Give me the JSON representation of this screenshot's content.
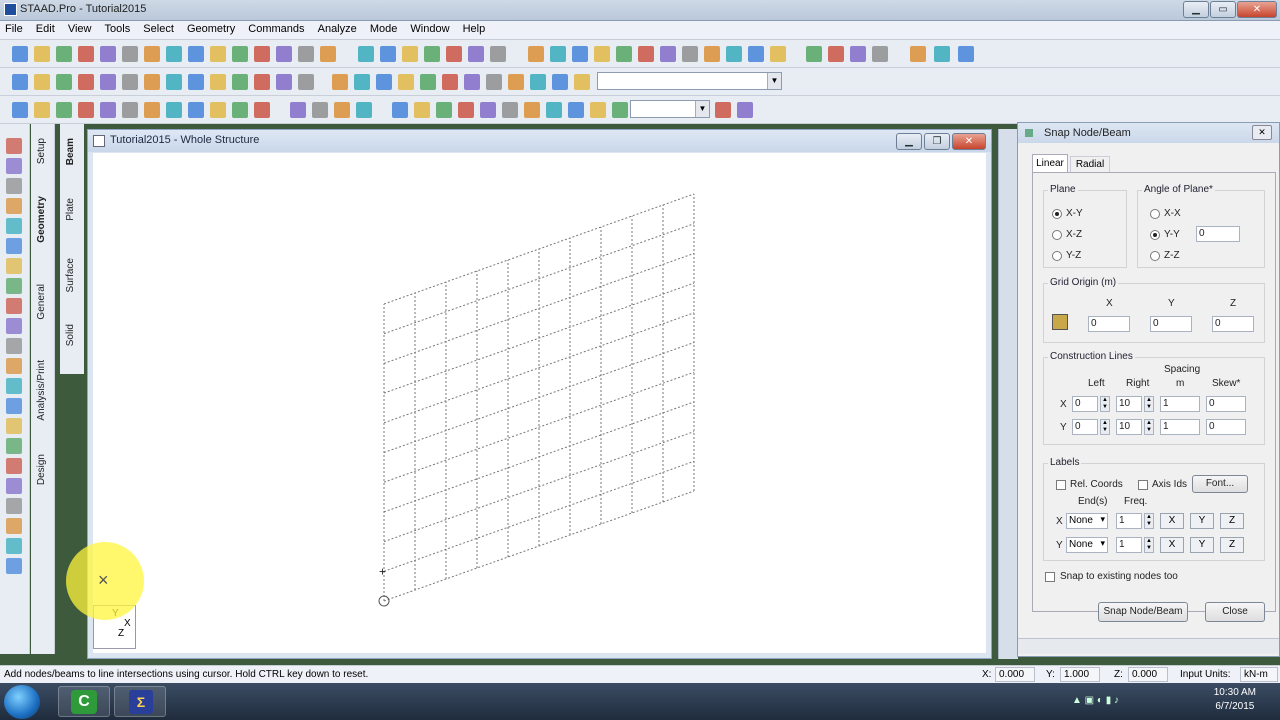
{
  "app": {
    "title": "STAAD.Pro - Tutorial2015"
  },
  "menu": [
    "File",
    "Edit",
    "View",
    "Tools",
    "Select",
    "Geometry",
    "Commands",
    "Analyze",
    "Mode",
    "Window",
    "Help"
  ],
  "left_tabs": {
    "primary": [
      "Setup",
      "Geometry",
      "General",
      "Analysis/Print",
      "Design"
    ],
    "secondary": [
      "Beam",
      "Plate",
      "Surface",
      "Solid"
    ]
  },
  "child_window": {
    "title": "Tutorial2015 - Whole Structure"
  },
  "snap_dialog": {
    "title": "Snap Node/Beam",
    "tabs": [
      "Linear",
      "Radial"
    ],
    "plane": {
      "legend": "Plane",
      "options": [
        "X-Y",
        "X-Z",
        "Y-Z"
      ],
      "selected": "X-Y"
    },
    "angle": {
      "legend": "Angle of Plane*",
      "options": [
        "X-X",
        "Y-Y",
        "Z-Z"
      ],
      "selected": "Y-Y",
      "value": "0"
    },
    "grid_origin": {
      "legend": "Grid Origin (m)",
      "x_label": "X",
      "y_label": "Y",
      "z_label": "Z",
      "x": "0",
      "y": "0",
      "z": "0"
    },
    "construction": {
      "legend": "Construction Lines",
      "headers": {
        "left": "Left",
        "right": "Right",
        "spacing": "Spacing",
        "unit": "m",
        "skew": "Skew*"
      },
      "rows": [
        {
          "axis": "X",
          "left": "0",
          "right": "10",
          "spacing": "1",
          "skew": "0"
        },
        {
          "axis": "Y",
          "left": "0",
          "right": "10",
          "spacing": "1",
          "skew": "0"
        }
      ]
    },
    "labels": {
      "legend": "Labels",
      "rel_coords": "Rel. Coords",
      "axis_ids": "Axis Ids",
      "font_button": "Font...",
      "ends_header": "End(s)",
      "freq_header": "Freq.",
      "rows": [
        {
          "axis": "X",
          "ends": "None",
          "freq": "1"
        },
        {
          "axis": "Y",
          "ends": "None",
          "freq": "1"
        }
      ],
      "axis_buttons": [
        "X",
        "Y",
        "Z"
      ]
    },
    "snap_existing": "Snap to existing nodes too",
    "snap_button": "Snap Node/Beam",
    "close_button": "Close"
  },
  "status": {
    "message": "Add nodes/beams to line intersections using cursor. Hold CTRL key down to reset.",
    "x_label": "X:",
    "x": "0.000",
    "y_label": "Y:",
    "y": "1.000",
    "z_label": "Z:",
    "z": "0.000",
    "units_label": "Input Units:",
    "units": "kN-m"
  },
  "axis_triad": {
    "x": "X",
    "y": "Y",
    "z": "Z"
  },
  "taskbar": {
    "time": "10:30 AM",
    "date": "6/7/2015"
  },
  "colors": {
    "accent": "#1f4e9c",
    "highlight": "#fff53c"
  }
}
